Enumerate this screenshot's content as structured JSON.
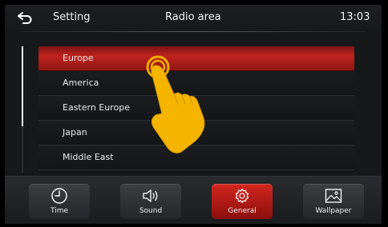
{
  "header": {
    "setting_label": "Setting",
    "title": "Radio area",
    "time": "13:03"
  },
  "list": {
    "items": [
      {
        "label": "Europe",
        "selected": true
      },
      {
        "label": "America",
        "selected": false
      },
      {
        "label": "Eastern Europe",
        "selected": false
      },
      {
        "label": "Japan",
        "selected": false
      },
      {
        "label": "Middle East",
        "selected": false
      }
    ]
  },
  "bottom_tabs": [
    {
      "label": "Time",
      "icon": "clock-icon",
      "active": false
    },
    {
      "label": "Sound",
      "icon": "speaker-icon",
      "active": false
    },
    {
      "label": "General",
      "icon": "gear-icon",
      "active": true
    },
    {
      "label": "Wallpaper",
      "icon": "image-icon",
      "active": false
    }
  ],
  "colors": {
    "accent": "#c0231e",
    "background": "#17181a",
    "hand": "#f5b400"
  }
}
